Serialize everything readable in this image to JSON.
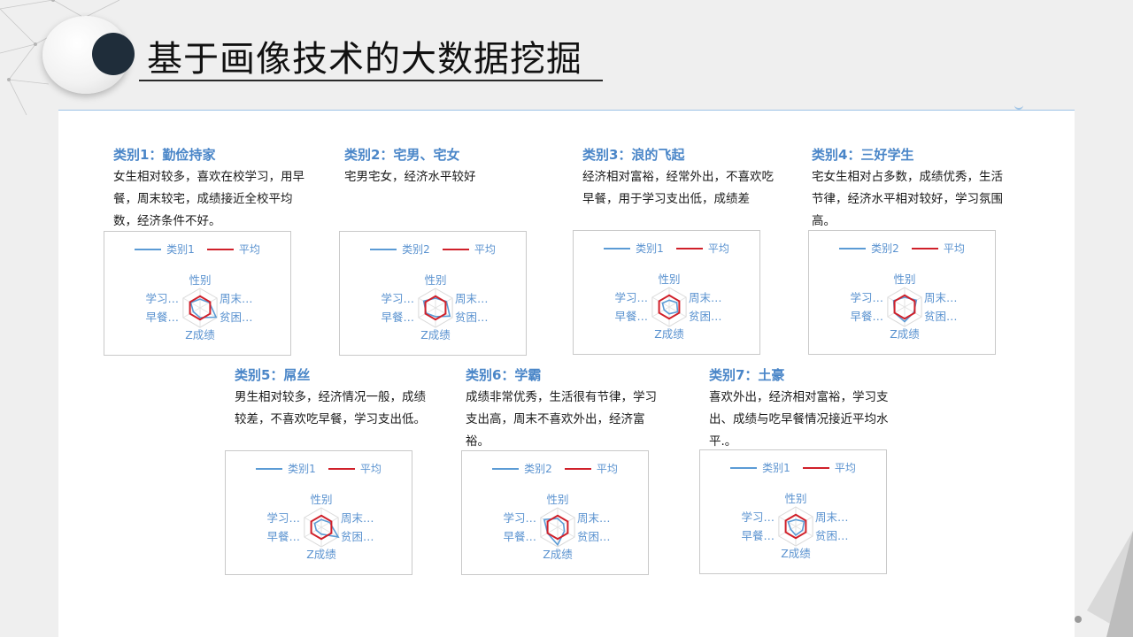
{
  "page": {
    "title": "基于画像技术的大数据挖掘"
  },
  "colors": {
    "accent": "#4a86c8",
    "series": "#5b9bd5",
    "average": "#d0202a",
    "title_dot": "#1f2d3a"
  },
  "categories": [
    {
      "title": "类别1：勤俭持家",
      "desc": "女生相对较多，喜欢在校学习，用早餐，周末较宅，成绩接近全校平均数，经济条件不好。",
      "chart": {
        "legend_series": "类别1",
        "legend_avg": "平均",
        "axes": [
          "性别",
          "周末…",
          "贫困…",
          "Z成绩",
          "早餐…",
          "学习…"
        ]
      }
    },
    {
      "title": "类别2：宅男、宅女",
      "desc": "宅男宅女，经济水平较好",
      "chart": {
        "legend_series": "类别2",
        "legend_avg": "平均",
        "axes": [
          "性别",
          "周末…",
          "贫困…",
          "Z成绩",
          "早餐…",
          "学习…"
        ]
      }
    },
    {
      "title": "类别3：浪的飞起",
      "desc": "经济相对富裕，经常外出，不喜欢吃早餐，用于学习支出低，成绩差",
      "chart": {
        "legend_series": "类别1",
        "legend_avg": "平均",
        "axes": [
          "性别",
          "周末…",
          "贫困…",
          "Z成绩",
          "早餐…",
          "学习…"
        ]
      }
    },
    {
      "title": "类别4：三好学生",
      "desc": "宅女生相对占多数，成绩优秀，生活节律，经济水平相对较好，学习氛围高。",
      "chart": {
        "legend_series": "类别2",
        "legend_avg": "平均",
        "axes": [
          "性别",
          "周末…",
          "贫困…",
          "Z成绩",
          "早餐…",
          "学习…"
        ]
      }
    },
    {
      "title": "类别5：屌丝",
      "desc": "男生相对较多，经济情况一般，成绩较差，不喜欢吃早餐，学习支出低。",
      "chart": {
        "legend_series": "类别1",
        "legend_avg": "平均",
        "axes": [
          "性别",
          "周末…",
          "贫困…",
          "Z成绩",
          "早餐…",
          "学习…"
        ]
      }
    },
    {
      "title": "类别6：学霸",
      "desc": "成绩非常优秀，生活很有节律，学习支出高，周末不喜欢外出，经济富裕。",
      "chart": {
        "legend_series": "类别2",
        "legend_avg": "平均",
        "axes": [
          "性别",
          "周末…",
          "贫困…",
          "Z成绩",
          "早餐…",
          "学习…"
        ]
      }
    },
    {
      "title": "类别7：土豪",
      "desc": "喜欢外出，经济相对富裕，学习支出、成绩与吃早餐情况接近平均水平.。",
      "chart": {
        "legend_series": "类别1",
        "legend_avg": "平均",
        "axes": [
          "性别",
          "周末…",
          "贫困…",
          "Z成绩",
          "早餐…",
          "学习…"
        ]
      }
    }
  ],
  "chart_data": [
    {
      "type": "radar",
      "axes": [
        "性别",
        "周末…",
        "贫困…",
        "Z成绩",
        "早餐…",
        "学习…"
      ],
      "series": [
        {
          "name": "类别1",
          "values": [
            0.45,
            0.55,
            0.95,
            0.5,
            0.4,
            0.55
          ]
        },
        {
          "name": "平均",
          "values": [
            0.6,
            0.6,
            0.6,
            0.6,
            0.6,
            0.6
          ]
        }
      ]
    },
    {
      "type": "radar",
      "axes": [
        "性别",
        "周末…",
        "贫困…",
        "Z成绩",
        "早餐…",
        "学习…"
      ],
      "series": [
        {
          "name": "类别2",
          "values": [
            0.5,
            0.65,
            0.85,
            0.45,
            0.55,
            0.7
          ]
        },
        {
          "name": "平均",
          "values": [
            0.6,
            0.6,
            0.6,
            0.6,
            0.6,
            0.6
          ]
        }
      ]
    },
    {
      "type": "radar",
      "axes": [
        "性别",
        "周末…",
        "贫困…",
        "Z成绩",
        "早餐…",
        "学习…"
      ],
      "series": [
        {
          "name": "类别1",
          "values": [
            0.35,
            0.45,
            0.5,
            0.35,
            0.3,
            0.4
          ]
        },
        {
          "name": "平均",
          "values": [
            0.6,
            0.6,
            0.6,
            0.6,
            0.6,
            0.6
          ]
        }
      ]
    },
    {
      "type": "radar",
      "axes": [
        "性别",
        "周末…",
        "贫困…",
        "Z成绩",
        "早餐…",
        "学习…"
      ],
      "series": [
        {
          "name": "类别2",
          "values": [
            0.5,
            0.7,
            0.55,
            0.75,
            0.6,
            0.65
          ]
        },
        {
          "name": "平均",
          "values": [
            0.6,
            0.6,
            0.6,
            0.6,
            0.6,
            0.6
          ]
        }
      ]
    },
    {
      "type": "radar",
      "axes": [
        "性别",
        "周末…",
        "贫困…",
        "Z成绩",
        "早餐…",
        "学习…"
      ],
      "series": [
        {
          "name": "类别1",
          "values": [
            0.4,
            0.5,
            1.0,
            0.35,
            0.3,
            0.4
          ]
        },
        {
          "name": "平均",
          "values": [
            0.6,
            0.6,
            0.6,
            0.6,
            0.6,
            0.6
          ]
        }
      ]
    },
    {
      "type": "radar",
      "axes": [
        "性别",
        "周末…",
        "贫困…",
        "Z成绩",
        "早餐…",
        "学习…"
      ],
      "series": [
        {
          "name": "类别2",
          "values": [
            0.45,
            0.35,
            0.4,
            0.9,
            0.6,
            0.8
          ]
        },
        {
          "name": "平均",
          "values": [
            0.6,
            0.6,
            0.6,
            0.6,
            0.6,
            0.6
          ]
        }
      ]
    },
    {
      "type": "radar",
      "axes": [
        "性别",
        "周末…",
        "贫困…",
        "Z成绩",
        "早餐…",
        "学习…"
      ],
      "series": [
        {
          "name": "类别1",
          "values": [
            0.35,
            0.5,
            0.4,
            0.45,
            0.3,
            0.45
          ]
        },
        {
          "name": "平均",
          "values": [
            0.6,
            0.6,
            0.6,
            0.6,
            0.6,
            0.6
          ]
        }
      ]
    }
  ]
}
